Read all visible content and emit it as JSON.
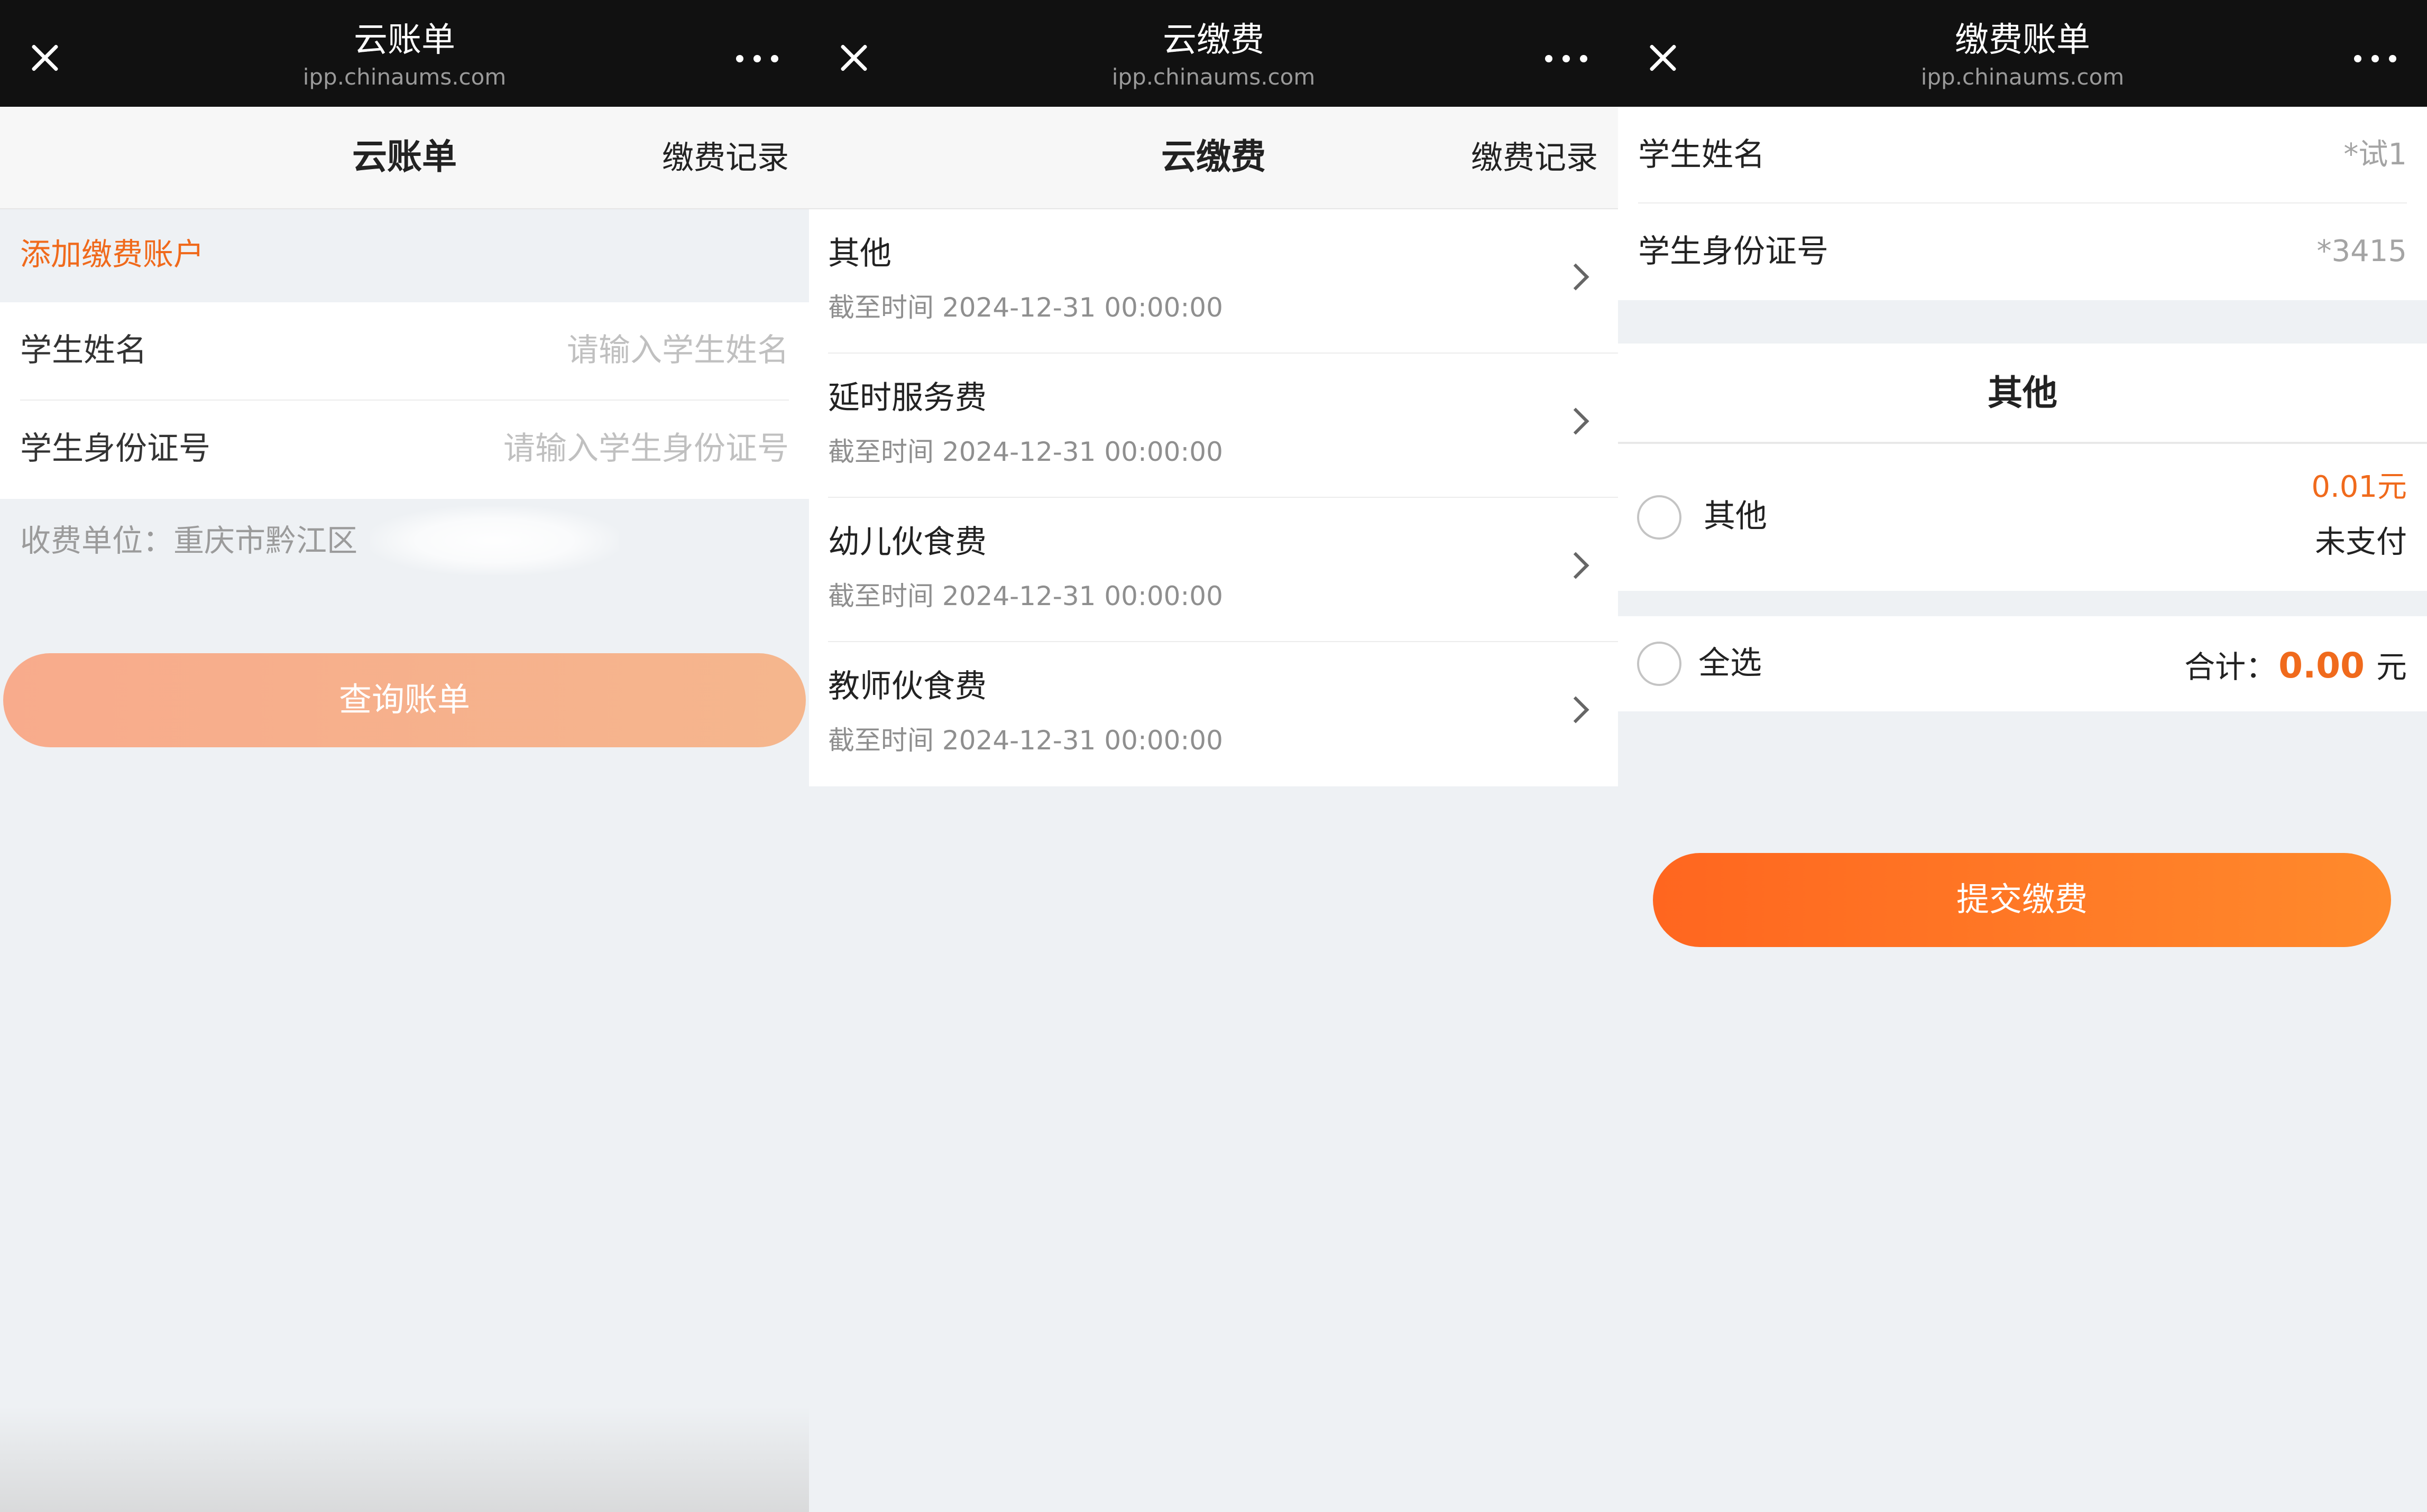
{
  "panels": [
    {
      "titlebar": {
        "title": "云账单",
        "url": "ipp.chinaums.com"
      },
      "nav": {
        "title": "云账单",
        "right_link": "缴费记录"
      },
      "add_account": "添加缴费账户",
      "form": {
        "name_label": "学生姓名",
        "name_placeholder": "请输入学生姓名",
        "id_label": "学生身份证号",
        "id_placeholder": "请输入学生身份证号"
      },
      "unit_text": "收费单位：重庆市黔江区",
      "query_button": "查询账单"
    },
    {
      "titlebar": {
        "title": "云缴费",
        "url": "ipp.chinaums.com"
      },
      "nav": {
        "title": "云缴费",
        "right_link": "缴费记录"
      },
      "fees": [
        {
          "name": "其他",
          "deadline": "截至时间 2024-12-31 00:00:00"
        },
        {
          "name": "延时服务费",
          "deadline": "截至时间 2024-12-31 00:00:00"
        },
        {
          "name": "幼儿伙食费",
          "deadline": "截至时间 2024-12-31 00:00:00"
        },
        {
          "name": "教师伙食费",
          "deadline": "截至时间 2024-12-31 00:00:00"
        }
      ]
    },
    {
      "titlebar": {
        "title": "缴费账单",
        "url": "ipp.chinaums.com"
      },
      "info": {
        "name_label": "学生姓名",
        "name_value": "*试1",
        "id_label": "学生身份证号",
        "id_value": "*3415"
      },
      "section_title": "其他",
      "bill": {
        "label": "其他",
        "amount": "0.01元",
        "status": "未支付"
      },
      "total": {
        "select_all": "全选",
        "label": "合计：",
        "amount": "0.00",
        "unit": "元"
      },
      "submit_button": "提交缴费"
    }
  ],
  "colors": {
    "accent": "#f06a1c",
    "titlebar_bg": "#111111",
    "page_bg": "#eef1f4",
    "query_button": "#f8ab8c",
    "submit_button": "#ff661f"
  },
  "icons": [
    "close-icon",
    "more-icon",
    "chevron-right-icon",
    "radio-icon"
  ]
}
